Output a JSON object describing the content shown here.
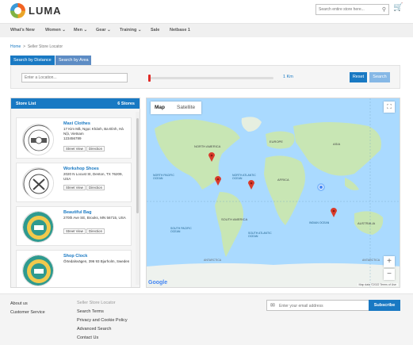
{
  "header": {
    "logo_text": "LUMA",
    "search_placeholder": "Search entire store here...",
    "cart_icon": "cart-icon"
  },
  "nav": {
    "items": [
      "What's New",
      "Women",
      "Men",
      "Gear",
      "Training",
      "Sale",
      "Netbase 1"
    ]
  },
  "breadcrumb": {
    "home": "Home",
    "sep": ">",
    "current": "Seller Store Locator"
  },
  "tabs": {
    "distance": "Search by Distance",
    "area": "Search by Area"
  },
  "filter": {
    "location_placeholder": "Enter a Location...",
    "radius_value": 1,
    "radius_text": "1 Km",
    "reset": "Reset",
    "search": "Search"
  },
  "store_list": {
    "title": "Store List",
    "count": "6 Stores",
    "stores": [
      {
        "name": "Maxi Clothes",
        "address": "17 Kim Mã, Ngọc Khánh, Ba Đình, Hà Nội, Vietnam",
        "phone": "123456789",
        "street_view": "Street View",
        "direction": "Direction"
      },
      {
        "name": "Workshop Shoes",
        "address": "2020 N Locust St, Denton, TX 76209, USA",
        "phone": "",
        "street_view": "Street View",
        "direction": "Direction"
      },
      {
        "name": "Beautiful Bag",
        "address": "270th Ave SE, Brooks, MN 56715, USA",
        "phone": "",
        "street_view": "Street View",
        "direction": "Direction"
      },
      {
        "name": "Shop Clock",
        "address": "Örtedalsvägen, 396 93 Bjurholm, Sweden",
        "phone": "",
        "street_view": "",
        "direction": ""
      }
    ]
  },
  "map": {
    "tab_map": "Map",
    "tab_satellite": "Satellite",
    "zoom_in": "+",
    "zoom_out": "−",
    "google": "Google",
    "footer_text": "Map data ©2022   Terms of Use",
    "ocean_labels": [
      "NORTH ATLANTIC OCEAN",
      "SOUTH ATLANTIC OCEAN",
      "INDIAN OCEAN",
      "NORTH PACIFIC OCEAN",
      "SOUTH PACIFIC OCEAN",
      "ANTARCTICA",
      "ANTARCTICA"
    ],
    "region_labels": [
      "NORTH AMERICA",
      "SOUTH AMERICA",
      "EUROPE",
      "AFRICA",
      "ASIA",
      "AUSTRALIA"
    ]
  },
  "footer": {
    "col1": [
      "About us",
      "Customer Service"
    ],
    "col2": [
      "Seller Store Locator",
      "Search Terms",
      "Privacy and Cookie Policy",
      "Advanced Search",
      "Contact Us"
    ],
    "email_placeholder": "Enter your email address",
    "subscribe": "Subscribe"
  },
  "colors": {
    "primary": "#1979c3",
    "tab_inactive": "#5d8cc4",
    "slider_handle": "#e02b27",
    "map_water": "#aadaff",
    "land": "#c8e6b4"
  }
}
